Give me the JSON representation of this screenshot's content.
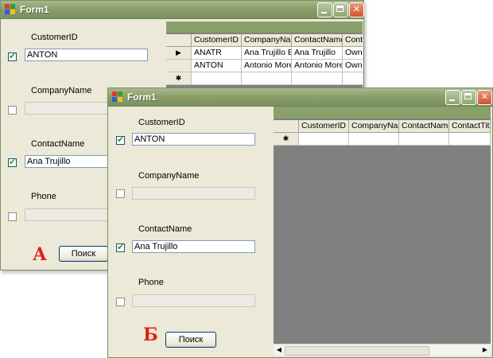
{
  "form_a": {
    "title": "Form1",
    "fields": [
      {
        "label": "CustomerID",
        "checked": true,
        "value": "ANTON"
      },
      {
        "label": "CompanyName",
        "checked": false,
        "value": ""
      },
      {
        "label": "ContactName",
        "checked": true,
        "value": "Ana Trujillo"
      },
      {
        "label": "Phone",
        "checked": false,
        "value": ""
      }
    ],
    "search_button": "Поиск",
    "marker": "А",
    "grid": {
      "columns": [
        "CustomerID",
        "CompanyNa",
        "ContactName",
        "Conta"
      ],
      "row_selector": "▶",
      "rows": [
        [
          "ANATR",
          "Ana Trujillo E",
          "Ana Trujillo",
          "Owne"
        ],
        [
          "ANTON",
          "Antonio More",
          "Antonio More",
          "Owne"
        ]
      ],
      "new_row_marker": "✱"
    }
  },
  "form_b": {
    "title": "Form1",
    "fields": [
      {
        "label": "CustomerID",
        "checked": true,
        "value": "ANTON"
      },
      {
        "label": "CompanyName",
        "checked": false,
        "value": ""
      },
      {
        "label": "ContactName",
        "checked": true,
        "value": "Ana Trujillo"
      },
      {
        "label": "Phone",
        "checked": false,
        "value": ""
      }
    ],
    "search_button": "Поиск",
    "marker": "Б",
    "grid": {
      "columns": [
        "CustomerID",
        "CompanyNa",
        "ContactName",
        "ContactTitle"
      ],
      "new_row_marker": "✱",
      "scroll_left": "◀",
      "scroll_right": "▶"
    }
  },
  "colors": {
    "titlebar": "#8aa06a",
    "window_bg": "#ece9d8",
    "grid_bg": "#808080",
    "marker": "#e0201a",
    "check": "#21a121"
  }
}
